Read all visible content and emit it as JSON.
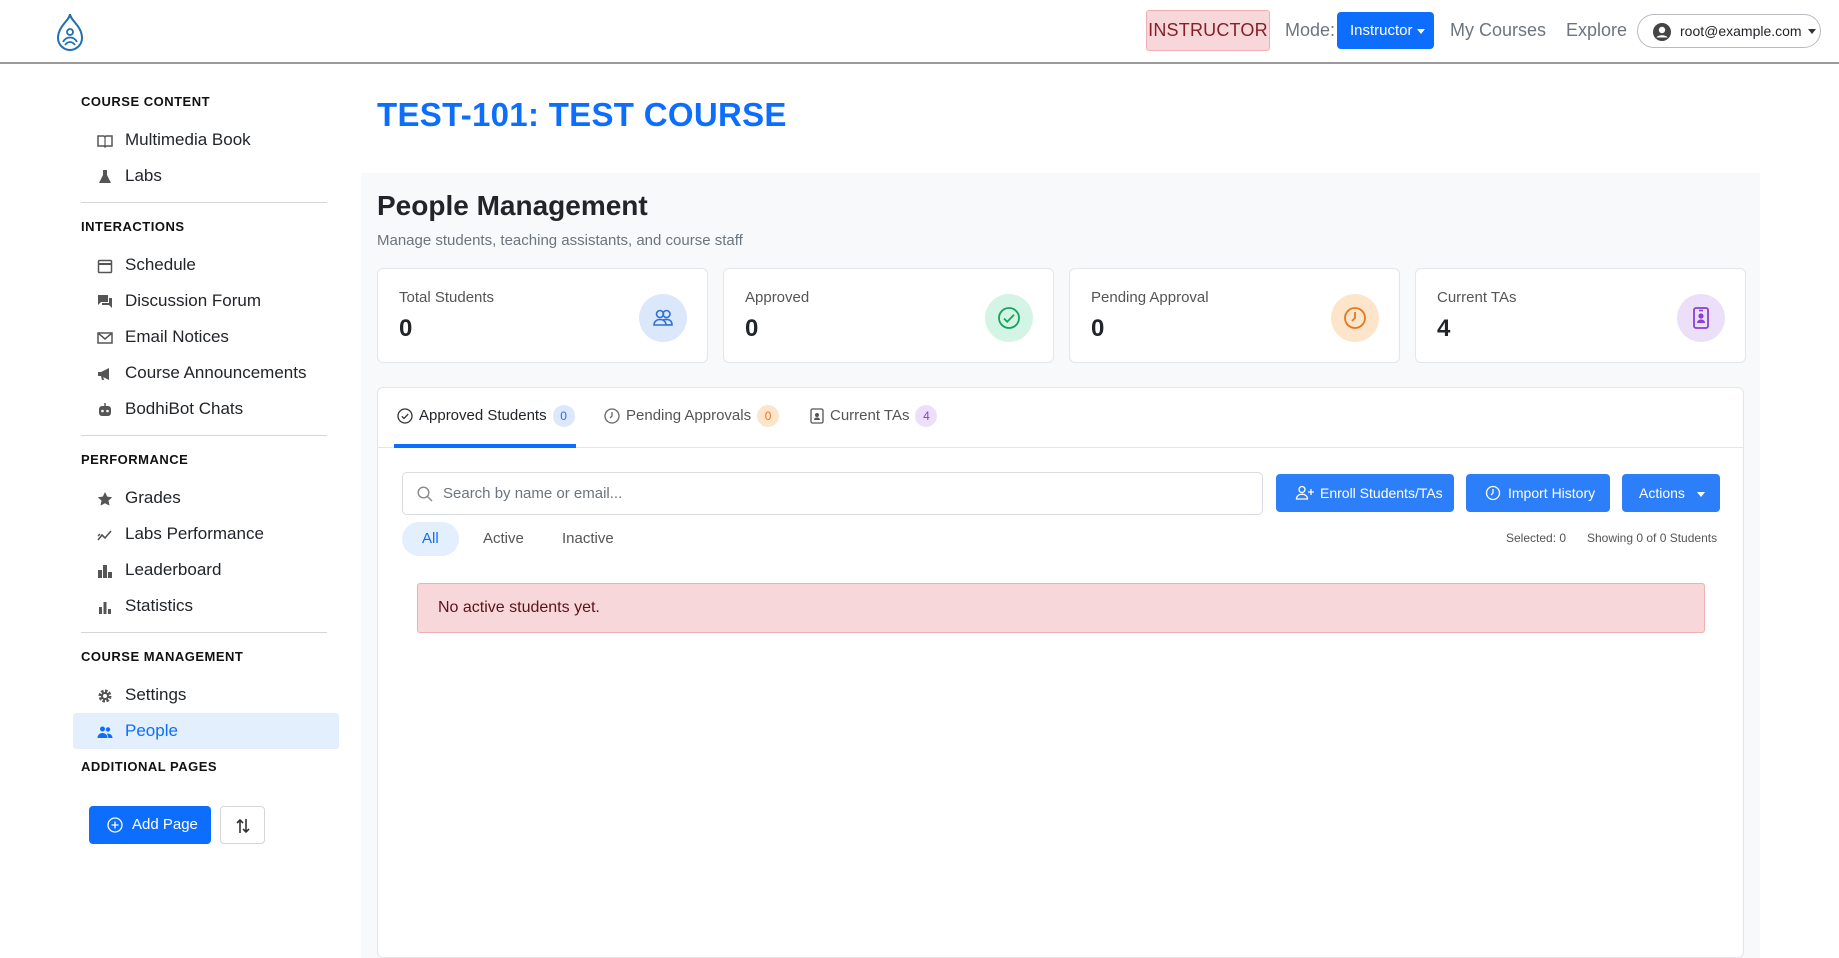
{
  "header": {
    "role_badge": "INSTRUCTOR",
    "mode_label": "Mode:",
    "mode_value": "Instructor",
    "nav": [
      "My Courses",
      "Explore"
    ],
    "user_email": "root@example.com"
  },
  "sidebar": {
    "sections": [
      {
        "title": "COURSE CONTENT",
        "items": [
          {
            "label": "Multimedia Book",
            "icon": "book-icon"
          },
          {
            "label": "Labs",
            "icon": "flask-icon"
          }
        ]
      },
      {
        "title": "INTERACTIONS",
        "items": [
          {
            "label": "Schedule",
            "icon": "calendar-icon"
          },
          {
            "label": "Discussion Forum",
            "icon": "forum-icon"
          },
          {
            "label": "Email Notices",
            "icon": "mail-icon"
          },
          {
            "label": "Course Announcements",
            "icon": "megaphone-icon"
          },
          {
            "label": "BodhiBot Chats",
            "icon": "robot-icon"
          }
        ]
      },
      {
        "title": "PERFORMANCE",
        "items": [
          {
            "label": "Grades",
            "icon": "star-icon"
          },
          {
            "label": "Labs Performance",
            "icon": "trend-icon"
          },
          {
            "label": "Leaderboard",
            "icon": "leaderboard-icon"
          },
          {
            "label": "Statistics",
            "icon": "bar-chart-icon"
          }
        ]
      },
      {
        "title": "COURSE MANAGEMENT",
        "items": [
          {
            "label": "Settings",
            "icon": "gear-icon"
          },
          {
            "label": "People",
            "icon": "people-icon",
            "active": true
          }
        ]
      }
    ],
    "additional_title": "ADDITIONAL PAGES",
    "add_page_label": "Add Page"
  },
  "main": {
    "course_title": "TEST-101: TEST COURSE",
    "page_title": "People Management",
    "page_subtitle": "Manage students, teaching assistants, and course staff",
    "stats": [
      {
        "label": "Total Students",
        "value": "0",
        "icon": "users-icon",
        "color": "#dbe7fb"
      },
      {
        "label": "Approved",
        "value": "0",
        "icon": "check-circle-icon",
        "color": "#d4f5e5"
      },
      {
        "label": "Pending Approval",
        "value": "0",
        "icon": "clock-icon",
        "color": "#fde5cc"
      },
      {
        "label": "Current TAs",
        "value": "4",
        "icon": "badge-icon",
        "color": "#ecdffa"
      }
    ],
    "tabs": [
      {
        "label": "Approved Students",
        "count": "0"
      },
      {
        "label": "Pending Approvals",
        "count": "0"
      },
      {
        "label": "Current TAs",
        "count": "4"
      }
    ],
    "search_placeholder": "Search by name or email...",
    "buttons": {
      "enroll": "Enroll Students/TAs",
      "import": "Import History",
      "actions": "Actions"
    },
    "filters": [
      "All",
      "Active",
      "Inactive"
    ],
    "selected_text": "Selected: 0",
    "showing_text": "Showing 0 of 0 Students",
    "empty_message": "No active students yet."
  },
  "colors": {
    "accent": "#0d6efd",
    "alert_bg": "#f8d7da"
  }
}
